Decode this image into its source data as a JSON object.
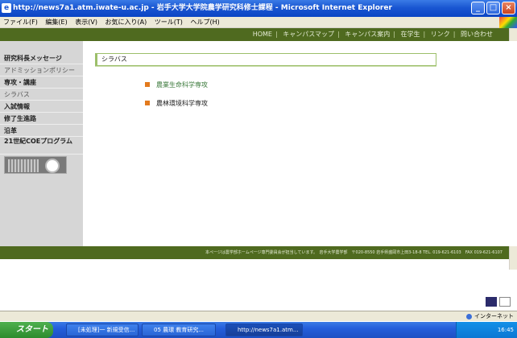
{
  "window": {
    "title": "http://news7a1.atm.iwate-u.ac.jp - 岩手大学大学院農学研究科修士課程 - Microsoft Internet Explorer"
  },
  "menubar": {
    "items": [
      "ファイル(F)",
      "編集(E)",
      "表示(V)",
      "お気に入り(A)",
      "ツール(T)",
      "ヘルプ(H)"
    ]
  },
  "sitenav": {
    "items": [
      "HOME",
      "キャンパスマップ",
      "キャンパス案内",
      "在学生",
      "リンク",
      "問い合わせ"
    ]
  },
  "sidebar": {
    "items": [
      "研究科長メッセージ",
      "アドミッションポリシー",
      "専攻・講座",
      "シラバス",
      "入試情報",
      "修了生進路",
      "沿革"
    ],
    "coe_label": "21世紀COEプログラム"
  },
  "main": {
    "section_title": "シラバス",
    "links": [
      "農業生命科学専攻",
      "農林環境科学専攻"
    ]
  },
  "footer": {
    "text": "本ページは農学部ホームページ専門委員会が担当しています。　岩手大学農学部　〒020-8550 岩手県盛岡市上田3-18-8 TEL. 019-621-6103　FAX 019-621-6107"
  },
  "statusbar": {
    "zone": "インターネット"
  },
  "taskbar": {
    "start": "スタート",
    "tasks": [
      "[未処理]一 新規受信...",
      "05 農環 教育研究...",
      "http://news7a1.atm..."
    ],
    "clock": "16:45"
  },
  "colors": {
    "site_green": "#4f6a1f",
    "bullet_orange": "#e37a1d",
    "sidebar_gray": "#d6d6d6"
  }
}
